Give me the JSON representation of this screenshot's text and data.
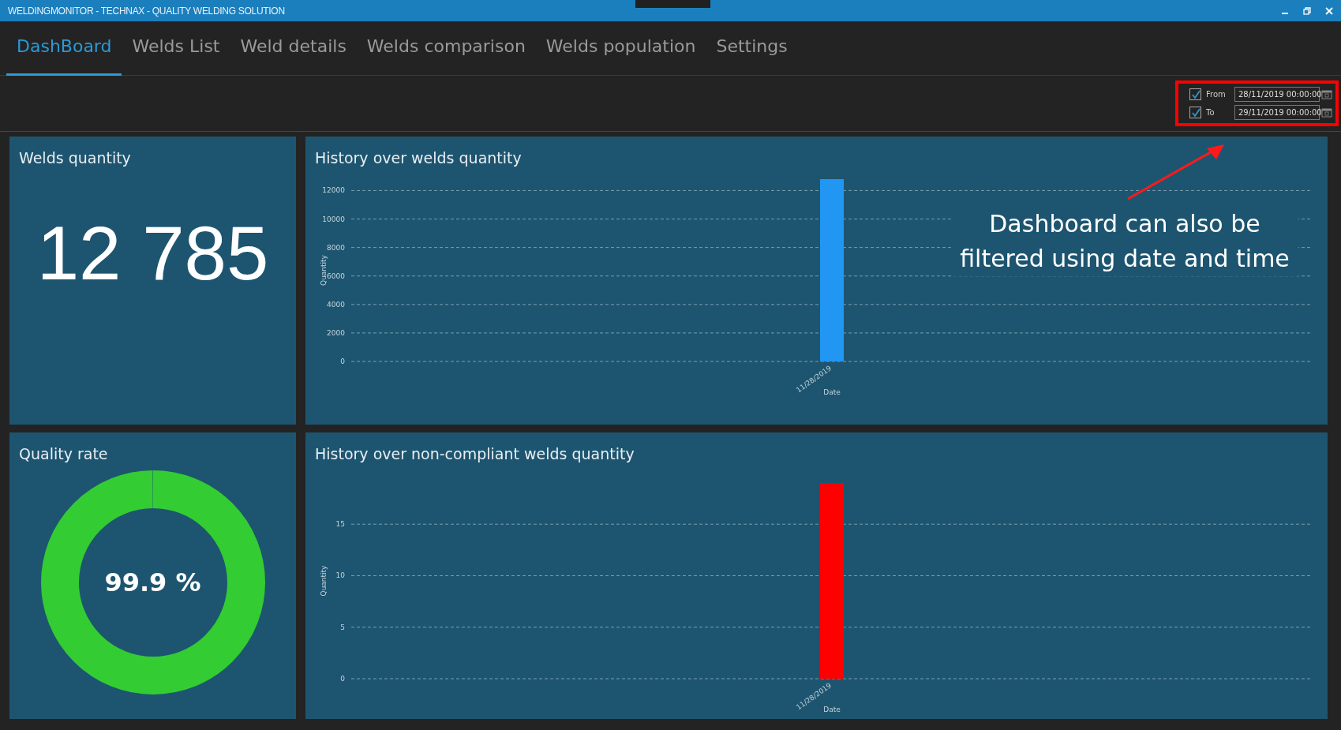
{
  "window": {
    "title": "WELDINGMONITOR - TECHNAX - QUALITY WELDING SOLUTION"
  },
  "tabs": [
    {
      "label": "DashBoard",
      "selected": true
    },
    {
      "label": "Welds List",
      "selected": false
    },
    {
      "label": "Weld details",
      "selected": false
    },
    {
      "label": "Welds comparison",
      "selected": false
    },
    {
      "label": "Welds population",
      "selected": false
    },
    {
      "label": "Settings",
      "selected": false
    }
  ],
  "filters": [
    {
      "label": "From",
      "checked": true,
      "value": "28/11/2019 00:00:00"
    },
    {
      "label": "To",
      "checked": true,
      "value": "29/11/2019 00:00:00"
    }
  ],
  "welds_quantity": {
    "title": "Welds quantity",
    "value": "12 785"
  },
  "quality_rate": {
    "title": "Quality rate",
    "value": "99.9 %",
    "level": 0.999
  },
  "history_welds": {
    "title": "History over welds quantity",
    "chart_data": {
      "type": "bar",
      "xlabel": "Date",
      "ylabel": "Quantity",
      "categories": [
        "11/28/2019"
      ],
      "series": [
        {
          "color": "#2196f3",
          "values": [
            12800
          ]
        }
      ],
      "grid": true,
      "ylim": [
        0,
        12800
      ],
      "yticks": [
        0,
        2000,
        4000,
        6000,
        8000,
        10000,
        12000
      ]
    }
  },
  "history_noncompliant": {
    "title": "History over non-compliant welds quantity",
    "chart_data": {
      "type": "bar",
      "xlabel": "Date",
      "ylabel": "Quantity",
      "categories": [
        "11/28/2019"
      ],
      "series": [
        {
          "color": "#ff0000",
          "values": [
            19
          ]
        }
      ],
      "grid": true,
      "ylim": [
        0,
        19
      ],
      "yticks": [
        0,
        5,
        10,
        15
      ]
    }
  },
  "annotation": "Dashboard can also be filtered using date and time"
}
